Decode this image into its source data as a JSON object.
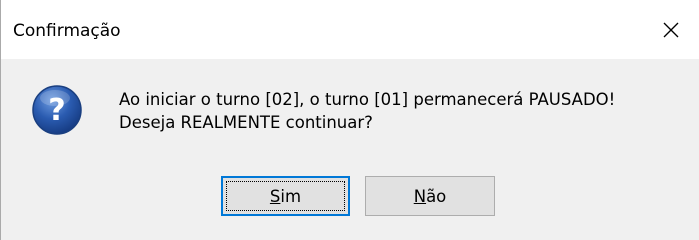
{
  "dialog": {
    "title": "Confirmação",
    "close_icon": "close-icon",
    "question_icon": "question-icon",
    "message_line1": "Ao iniciar o turno [02], o turno [01] permanecerá PAUSADO!",
    "message_line2": "Deseja REALMENTE continuar?",
    "buttons": {
      "yes_label": "Sim",
      "no_label": "Não"
    },
    "colors": {
      "icon_blue": "#2a5bb0",
      "focus_border": "#0078d7"
    }
  }
}
